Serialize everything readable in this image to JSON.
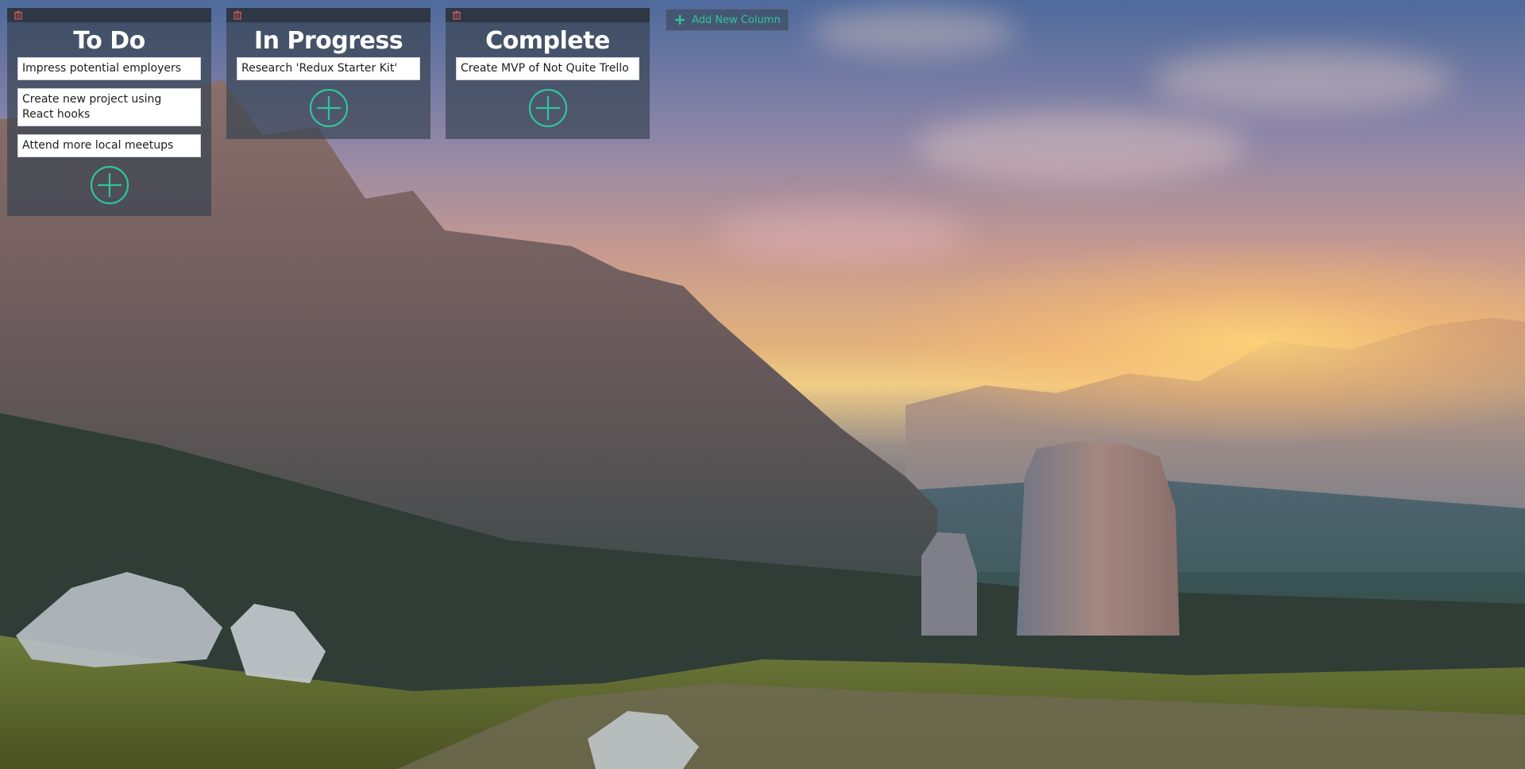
{
  "board": {
    "columns": [
      {
        "title": "To Do",
        "cards": [
          "Impress potential employers",
          "Create new project using React hooks",
          "Attend more local meetups"
        ]
      },
      {
        "title": "In Progress",
        "cards": [
          "Research 'Redux Starter Kit'"
        ]
      },
      {
        "title": "Complete",
        "cards": [
          "Create MVP of Not Quite Trello"
        ]
      }
    ],
    "add_column_label": "Add New Column"
  },
  "icons": {
    "delete_column": "trash-icon",
    "add_card": "plus-circle-icon",
    "add_column": "plus-icon"
  },
  "colors": {
    "accent": "#2ec59a",
    "column_bg": "#374250",
    "card_bg": "#ffffff"
  }
}
